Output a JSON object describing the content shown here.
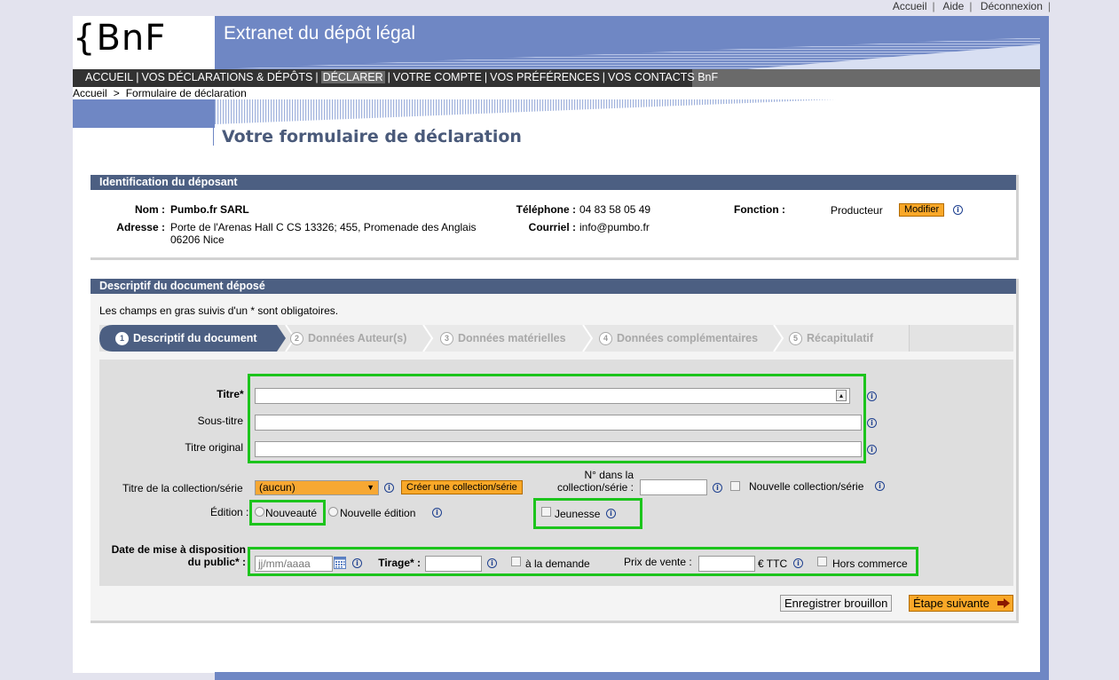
{
  "toplinks": [
    "Accueil",
    "Aide",
    "Déconnexion"
  ],
  "logo": "{BnF",
  "banner_title": "Extranet du dépôt légal",
  "nav": {
    "items": [
      "ACCUEIL",
      "VOS DÉCLARATIONS & DÉPÔTS",
      "DÉCLARER",
      "VOTRE COMPTE",
      "VOS PRÉFÉRENCES",
      "VOS CONTACTS BnF"
    ],
    "selected": "DÉCLARER"
  },
  "breadcrumb": [
    "Accueil",
    "Formulaire de déclaration"
  ],
  "page_title": "Votre formulaire de déclaration",
  "depositor": {
    "heading": "Identification du déposant",
    "nom_label": "Nom :",
    "nom_value": "Pumbo.fr SARL",
    "adresse_label": "Adresse :",
    "adresse_line1": "Porte de l'Arenas Hall C CS 13326; 455, Promenade des Anglais",
    "adresse_line2": "06206 Nice",
    "telephone_label": "Téléphone :",
    "telephone_value": "04 83 58 05 49",
    "courriel_label": "Courriel :",
    "courriel_value": "info@pumbo.fr",
    "fonction_label": "Fonction :",
    "fonction_value": "Producteur",
    "modifier_label": "Modifier"
  },
  "document": {
    "heading": "Descriptif du document déposé",
    "required_note": "Les champs en gras suivis d'un * sont obligatoires.",
    "steps": [
      {
        "num": "1",
        "label": "Descriptif du document",
        "active": true
      },
      {
        "num": "2",
        "label": "Données Auteur(s)",
        "active": false
      },
      {
        "num": "3",
        "label": "Données matérielles",
        "active": false
      },
      {
        "num": "4",
        "label": "Données complémentaires",
        "active": false
      },
      {
        "num": "5",
        "label": "Récapitulatif",
        "active": false
      }
    ],
    "titre_label": "Titre* :",
    "titre_value": "",
    "soustitre_label": "Sous-titre",
    "soustitre_value": "",
    "titreorig_label": "Titre original",
    "titreorig_value": "",
    "collection_label": "Titre de la collection/série",
    "collection_selected": "(aucun)",
    "creer_collection_label": "Créer une collection/série",
    "numero_label_line1": "N° dans la",
    "numero_label_line2": "collection/série :",
    "numero_value": "",
    "nouvelle_collection_label": "Nouvelle collection/série",
    "edition_label": "Édition :",
    "nouveaute_label": "Nouveauté",
    "nouvelle_edition_label": "Nouvelle édition",
    "jeunesse_label": "Jeunesse",
    "date_label_line1": "Date de mise à disposition",
    "date_label_line2": "du public* :",
    "date_placeholder": "jj/mm/aaaa",
    "tirage_label": "Tirage* :",
    "a_la_demande_label": "à la demande",
    "prix_label": "Prix de vente :",
    "prix_value": "",
    "ttc_label": "€ TTC",
    "hors_commerce_label": "Hors commerce",
    "enregistrer_label": "Enregistrer brouillon",
    "etape_label": "Étape suivante"
  },
  "colors": {
    "banner": "#6f87c4",
    "panel_head": "#4c5f82",
    "highlight": "#1cc41c",
    "orange": "#f9a828"
  }
}
